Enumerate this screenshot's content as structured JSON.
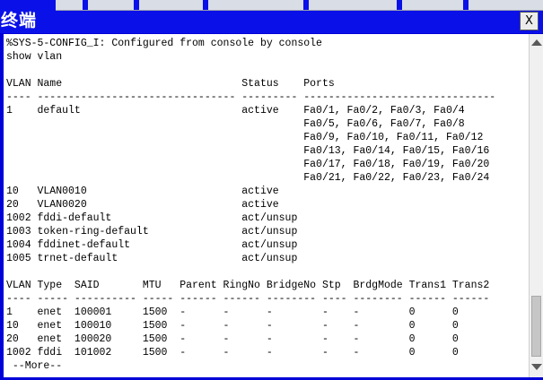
{
  "window": {
    "title": "终端",
    "close_label": "X"
  },
  "terminal": {
    "lines": [
      "%SYS-5-CONFIG_I: Configured from console by console",
      "show vlan",
      "",
      "VLAN Name                             Status    Ports",
      "---- -------------------------------- --------- -------------------------------",
      "1    default                          active    Fa0/1, Fa0/2, Fa0/3, Fa0/4",
      "                                                Fa0/5, Fa0/6, Fa0/7, Fa0/8",
      "                                                Fa0/9, Fa0/10, Fa0/11, Fa0/12",
      "                                                Fa0/13, Fa0/14, Fa0/15, Fa0/16",
      "                                                Fa0/17, Fa0/18, Fa0/19, Fa0/20",
      "                                                Fa0/21, Fa0/22, Fa0/23, Fa0/24",
      "10   VLAN0010                         active",
      "20   VLAN0020                         active",
      "1002 fddi-default                     act/unsup",
      "1003 token-ring-default               act/unsup",
      "1004 fddinet-default                  act/unsup",
      "1005 trnet-default                    act/unsup",
      "",
      "VLAN Type  SAID       MTU   Parent RingNo BridgeNo Stp  BrdgMode Trans1 Trans2",
      "---- ----- ---------- ----- ------ ------ -------- ---- -------- ------ ------",
      "1    enet  100001     1500  -      -      -        -    -        0      0",
      "10   enet  100010     1500  -      -      -        -    -        0      0",
      "20   enet  100020     1500  -      -      -        -    -        0      0",
      "1002 fddi  101002     1500  -      -      -        -    -        0      0",
      " --More--"
    ]
  }
}
